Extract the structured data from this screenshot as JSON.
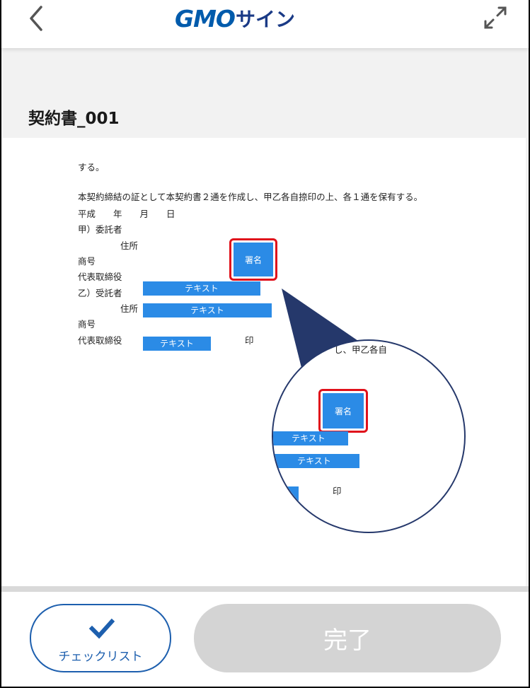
{
  "header": {
    "logo_gmo": "GMO",
    "logo_sign": "サイン"
  },
  "document": {
    "title": "契約書_001",
    "lines": {
      "l1": "する。",
      "l2": "本契約締結の証として本契約書２通を作成し、甲乙各自捺印の上、各１通を保有する。",
      "l3": "平成　　年　　月　　日",
      "l4": "甲）委託者",
      "l5": "住所",
      "l6": "商号",
      "l7": "代表取締役",
      "l8": "乙）受託者",
      "l9": "住所",
      "l10": "商号",
      "l11": "代表取締役",
      "seal": "印"
    },
    "fields": {
      "sign": "署名",
      "text1": "テキスト",
      "text2": "テキスト",
      "text3": "テキスト"
    }
  },
  "magnifier": {
    "top_text": "し、甲乙各自",
    "sign": "署名",
    "text1": "テキスト",
    "text2": "テキスト",
    "seal": "印"
  },
  "bottom": {
    "checklist_label": "チェックリスト",
    "complete_label": "完了"
  },
  "colors": {
    "brand": "#005bac",
    "field_blue": "#2b8be6",
    "highlight_red": "#e0111b",
    "button_disabled": "#d4d4d4",
    "magnifier_border": "#25386b"
  }
}
